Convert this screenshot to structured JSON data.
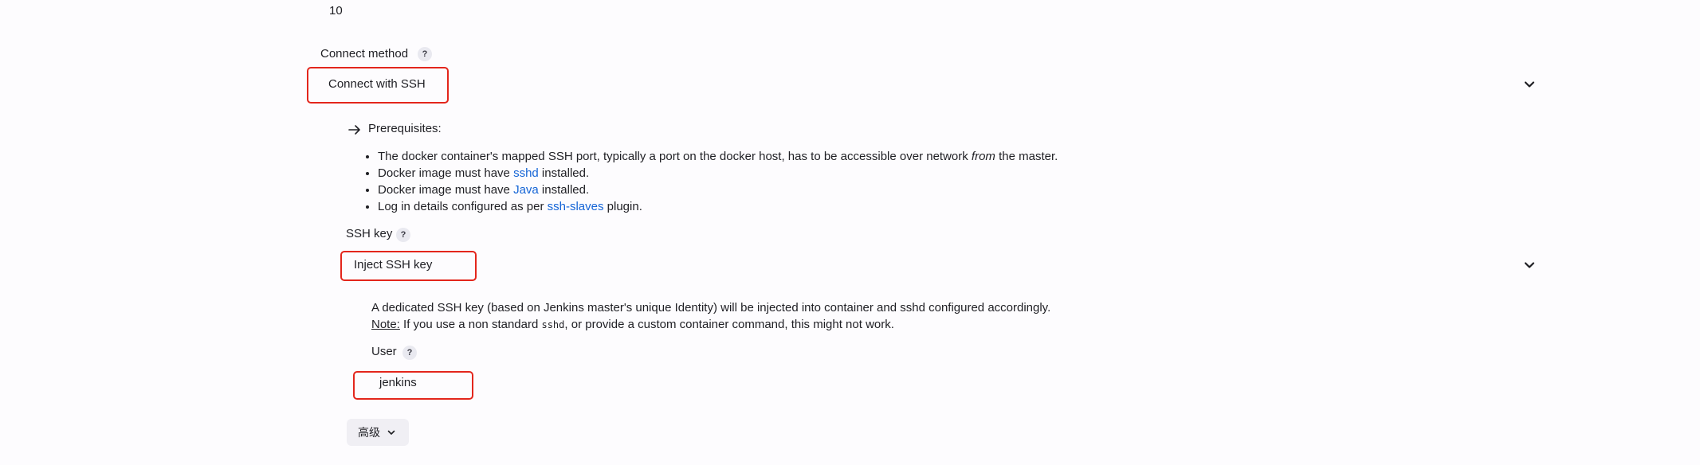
{
  "prev_field": {
    "value": "10"
  },
  "connect_method": {
    "label": "Connect method",
    "help": "?",
    "selected": "Connect with SSH"
  },
  "prerequisites": {
    "heading": "Prerequisites:",
    "items": [
      {
        "before": "The docker container's mapped SSH port, typically a port on the docker host, has to be accessible over network ",
        "emphasis": "from",
        "after": " the master."
      },
      {
        "before": "Docker image must have ",
        "link": "sshd",
        "after": " installed."
      },
      {
        "before": "Docker image must have ",
        "link": "Java",
        "after": " installed."
      },
      {
        "before": "Log in details configured as per ",
        "link": "ssh-slaves",
        "after": " plugin."
      }
    ]
  },
  "ssh_key": {
    "label": "SSH key",
    "help": "?",
    "selected": "Inject SSH key",
    "description": "A dedicated SSH key (based on Jenkins master's unique Identity) will be injected into container and sshd configured accordingly.",
    "note_label": "Note:",
    "note_before": " If you use a non standard ",
    "note_code": "sshd",
    "note_after": ", or provide a custom container command, this might not work."
  },
  "user": {
    "label": "User",
    "help": "?",
    "value": "jenkins"
  },
  "advanced": {
    "label": "高级"
  },
  "colors": {
    "link": "#1464d6",
    "highlight_box": "#e3261c",
    "background": "#fdfcfe"
  }
}
